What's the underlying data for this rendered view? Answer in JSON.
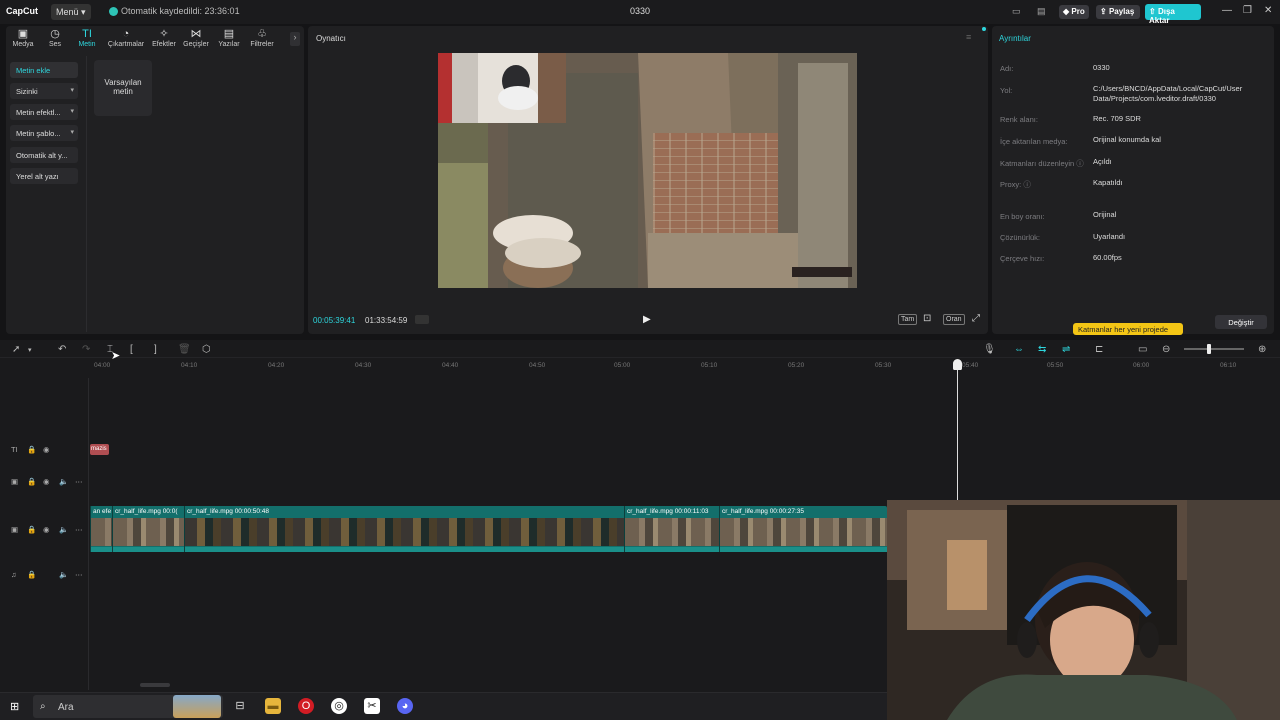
{
  "titlebar": {
    "logo": "CapCut",
    "menu": "Menü",
    "autosave": "Otomatik kaydedildi: 23:36:01",
    "project": "0330",
    "pro": "Pro",
    "share": "Paylaş",
    "export": "Dışa Aktar",
    "minimize": "—",
    "restore": "❐",
    "close": "✕"
  },
  "toolbar": {
    "tabs": [
      {
        "label": "Medya",
        "icon": "▣"
      },
      {
        "label": "Ses",
        "icon": "◷"
      },
      {
        "label": "Metin",
        "icon": "TI"
      },
      {
        "label": "Çıkartmalar",
        "icon": "◔"
      },
      {
        "label": "Efektler",
        "icon": "✧"
      },
      {
        "label": "Geçişler",
        "icon": "⋈"
      },
      {
        "label": "Yazılar",
        "icon": "▤"
      },
      {
        "label": "Filtreler",
        "icon": "♧"
      }
    ],
    "more": "›"
  },
  "text_panel": {
    "items": [
      {
        "label": "Metin ekle"
      },
      {
        "label": "Sizinki"
      },
      {
        "label": "Metin efektl..."
      },
      {
        "label": "Metin şablo..."
      },
      {
        "label": "Otomatik alt y..."
      },
      {
        "label": "Yerel alt yazı"
      }
    ],
    "default_card": "Varsayılan metin"
  },
  "player": {
    "title": "Oynatıcı",
    "current_time": "00:05:39:41",
    "total_time": "01:33:54:59",
    "full": "Tam",
    "ratio": "Oran"
  },
  "details": {
    "title": "Ayrıntılar",
    "rows": [
      {
        "label": "Adı:",
        "value": "0330"
      },
      {
        "label": "Yol:",
        "value": "C:/Users/BNCD/AppData/Local/CapCut/User Data/Projects/com.lveditor.draft/0330"
      },
      {
        "label": "Renk alanı:",
        "value": "Rec. 709 SDR"
      },
      {
        "label": "İçe aktarılan medya:",
        "value": "Orijinal konumda kal"
      },
      {
        "label": "Katmanları düzenleyin ⓘ",
        "value": "Açıldı"
      },
      {
        "label": "Proxy: ⓘ",
        "value": "Kapatıldı"
      },
      {
        "label": "En boy oranı:",
        "value": "Orijinal"
      },
      {
        "label": "Çözünürlük:",
        "value": "Uyarlandı"
      },
      {
        "label": "Çerçeve hızı:",
        "value": "60.00fps"
      }
    ],
    "tooltip": "Katmanlar her yeni projede",
    "change": "Değiştir"
  },
  "timeline": {
    "ruler": [
      "04:00",
      "04:10",
      "04:20",
      "04:30",
      "04:40",
      "04:50",
      "05:00",
      "05:10",
      "05:20",
      "05:30",
      "05:40",
      "05:50",
      "06:00",
      "06:10"
    ],
    "text_clip": "mazis",
    "clips": [
      {
        "label": "an efe"
      },
      {
        "label": "cr_half_life.mpg  00:0("
      },
      {
        "label": "cr_half_life.mpg   00:00:50:48"
      },
      {
        "label": "cr_half_life.mpg   00:00:11:03"
      },
      {
        "label": "cr_half_life.mpg   00:00:27:35"
      }
    ]
  },
  "taskbar": {
    "search": "Ara"
  }
}
